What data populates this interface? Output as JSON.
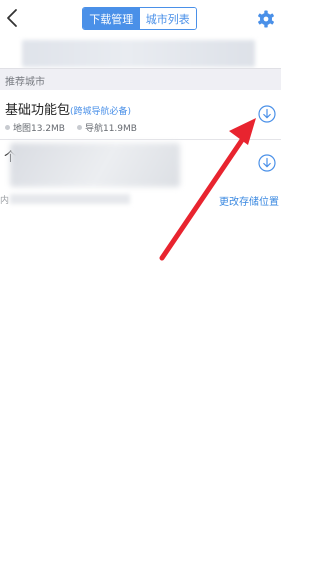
{
  "header": {
    "tabs": [
      {
        "label": "下载管理",
        "active": true
      },
      {
        "label": "城市列表",
        "active": false
      }
    ]
  },
  "section": {
    "title": "推荐城市"
  },
  "items": [
    {
      "title": "基础功能包",
      "subtitle": "(跨城导航必备)",
      "map_size_label": "地图13.2MB",
      "nav_size_label": "导航11.9MB"
    },
    {
      "title_visible": "个"
    }
  ],
  "storage": {
    "note_visible": "内",
    "change_link": "更改存储位置"
  },
  "colors": {
    "accent": "#4a90e8",
    "annotation_arrow": "#e8242f"
  },
  "icons": {
    "back": "chevron-left-icon",
    "settings": "gear-icon",
    "download": "download-circle-icon"
  }
}
